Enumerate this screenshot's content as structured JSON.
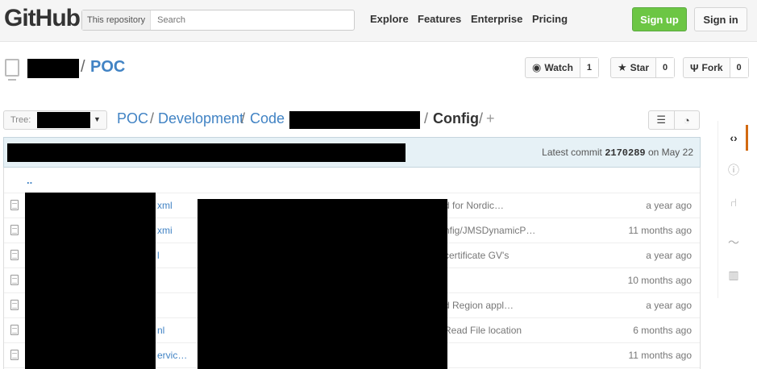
{
  "header": {
    "logo": "GitHub",
    "search_scope": "This repository",
    "search_placeholder": "Search",
    "nav": [
      "Explore",
      "Features",
      "Enterprise",
      "Pricing"
    ],
    "signup_label": "Sign up",
    "signin_label": "Sign in"
  },
  "repo": {
    "separator": "/",
    "name": "POC",
    "watch_label": "Watch",
    "watch_count": "1",
    "star_label": "Star",
    "star_count": "0",
    "fork_label": "Fork",
    "fork_count": "0"
  },
  "path": {
    "tree_label": "Tree:",
    "crumbs": [
      "POC",
      "Development",
      "Code"
    ],
    "sep": "/",
    "current": "Config",
    "plus": "+"
  },
  "commit": {
    "prefix": "Latest commit",
    "sha": "2170289",
    "suffix": "on May 22"
  },
  "files": {
    "up": "..",
    "rows": [
      {
        "name": "xml",
        "message": "d for Nordic…",
        "age": "a year ago"
      },
      {
        "name": "xmi",
        "message": "nfig/JMSDynamicP…",
        "age": "11 months ago"
      },
      {
        "name": "l",
        "message": "certificate GV's",
        "age": "a year ago"
      },
      {
        "name": "",
        "message": "",
        "age": "10 months ago"
      },
      {
        "name": "",
        "message": "d Region appl…",
        "age": "a year ago"
      },
      {
        "name": "nl",
        "message": "Read File location",
        "age": "6 months ago"
      },
      {
        "name": "ervic…",
        "message": "",
        "age": "11 months ago"
      }
    ]
  },
  "icons": {
    "watch": "eye-icon",
    "star": "star-icon",
    "fork": "fork-icon",
    "list_view": "list-icon",
    "history": "history-icon",
    "file": "file-icon",
    "repo": "repo-icon",
    "sidebar": [
      "code-icon",
      "issue-icon",
      "pull-request-icon",
      "pulse-icon",
      "graph-icon"
    ]
  },
  "colors": {
    "link": "#4183c4",
    "signup": "#6cc644",
    "commit_bar": "#e6f1f6",
    "active_tab": "#d26911"
  }
}
